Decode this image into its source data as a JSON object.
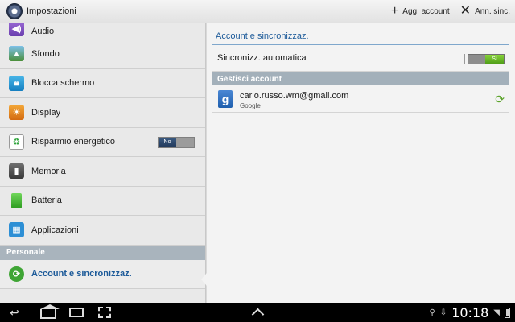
{
  "actionbar": {
    "title": "Impostazioni",
    "add_account": "Agg. account",
    "cancel_sync": "Ann. sinc."
  },
  "left": {
    "items": [
      {
        "label": "Audio",
        "icon": "volume-icon"
      },
      {
        "label": "Sfondo",
        "icon": "wallpaper-icon"
      },
      {
        "label": "Blocca schermo",
        "icon": "lock-icon"
      },
      {
        "label": "Display",
        "icon": "brightness-icon"
      },
      {
        "label": "Risparmio energetico",
        "icon": "recycle-icon",
        "toggle": "No"
      },
      {
        "label": "Memoria",
        "icon": "memory-card-icon"
      },
      {
        "label": "Batteria",
        "icon": "battery-icon"
      },
      {
        "label": "Applicazioni",
        "icon": "apps-grid-icon"
      }
    ],
    "section": "Personale",
    "selected": {
      "label": "Account e sincronizzaz.",
      "icon": "sync-icon"
    }
  },
  "right": {
    "title": "Account e sincronizzaz.",
    "auto_sync": {
      "label": "Sincronizz. automatica",
      "toggle": "Sì"
    },
    "section": "Gestisci account",
    "account": {
      "email": "carlo.russo.wm@gmail.com",
      "type": "Google",
      "icon_letter": "g"
    }
  },
  "statusbar": {
    "time": "10:18"
  },
  "colors": {
    "accent": "#1c5a99",
    "toggle_on": "#6bbf2a",
    "section_bg": "#a3b0ba"
  }
}
